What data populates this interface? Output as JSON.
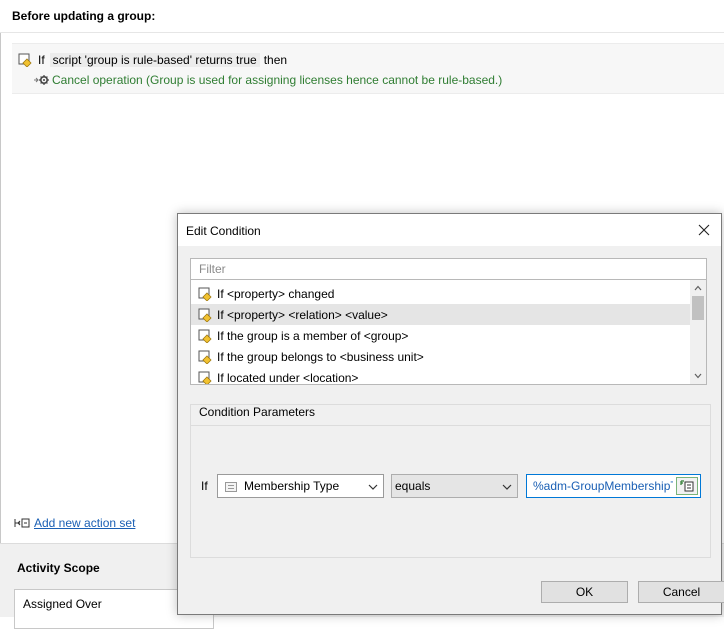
{
  "header": {
    "title": "Before updating a group:"
  },
  "rule": {
    "if_label": "If",
    "expression": "script 'group is rule-based' returns true",
    "then_label": "then",
    "action": "Cancel operation (Group is used for assigning licenses hence cannot be rule-based.)"
  },
  "add_action_set": "Add new action set",
  "scope": {
    "title": "Activity Scope",
    "first_item": "Assigned Over"
  },
  "dialog": {
    "title": "Edit Condition",
    "filter_placeholder": "Filter",
    "conditions": [
      {
        "label": "If <property> changed",
        "selected": false
      },
      {
        "label": "If <property> <relation> <value>",
        "selected": true
      },
      {
        "label": "If the group is a member of <group>",
        "selected": false
      },
      {
        "label": "If the group belongs to <business unit>",
        "selected": false
      },
      {
        "label": "If located under <location>",
        "selected": false
      }
    ],
    "params": {
      "group_label": "Condition Parameters",
      "if_label": "If",
      "property": "Membership Type",
      "relation": "equals",
      "value": "%adm-GroupMembershipTyp"
    },
    "ok_label": "OK",
    "cancel_label": "Cancel"
  },
  "colors": {
    "action_green": "#2f7d32",
    "link_blue": "#1a5fb4",
    "focus_blue": "#0078d7"
  }
}
